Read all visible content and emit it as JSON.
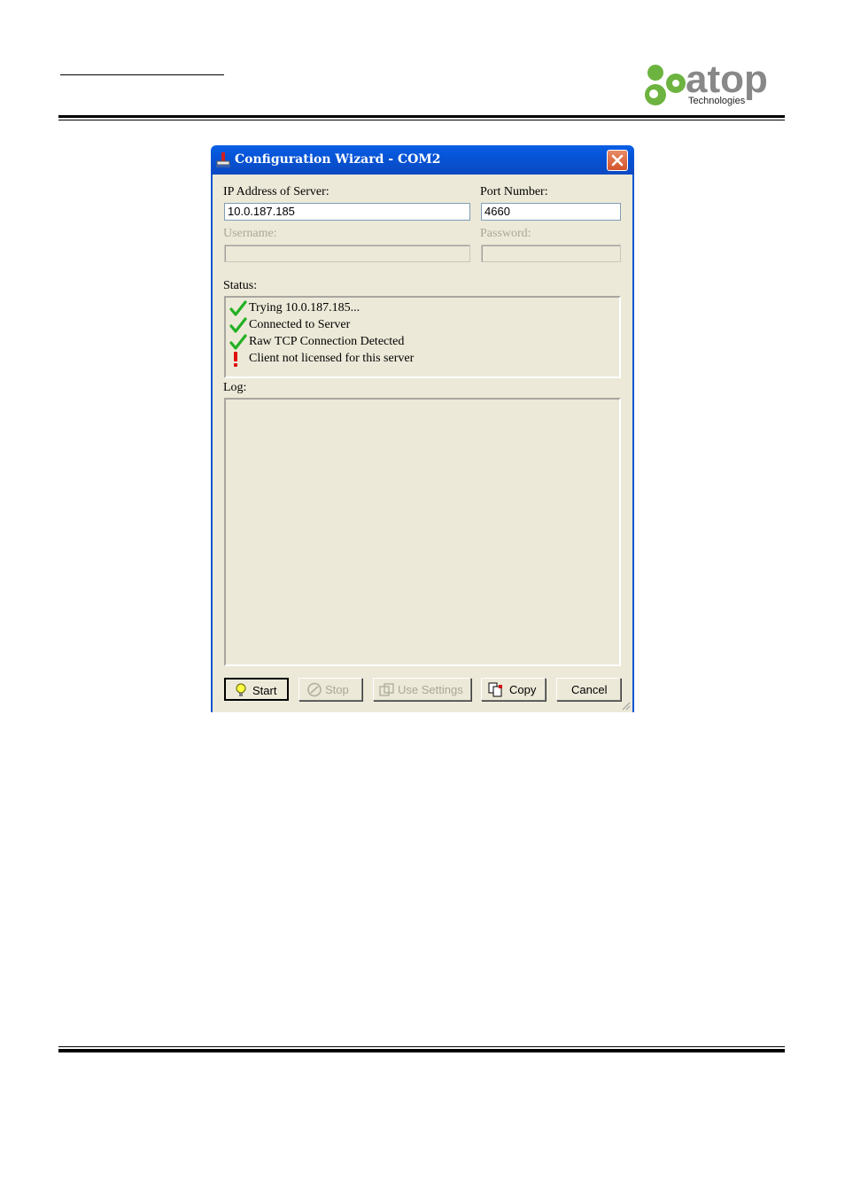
{
  "logo": {
    "wordmark": "atop",
    "tagline": "Technologies",
    "brand_colors": {
      "green": "#6cb33f",
      "grey": "#888888"
    }
  },
  "window": {
    "title": "Configuration Wizard - COM2",
    "close_icon": "close-x-icon",
    "fields": {
      "ip_label": "IP Address of Server:",
      "ip_value": "10.0.187.185",
      "port_label": "Port Number:",
      "port_value": "4660",
      "username_label": "Username:",
      "username_value": "",
      "password_label": "Password:",
      "password_value": ""
    },
    "status": {
      "label": "Status:",
      "items": [
        {
          "icon": "green-check-icon",
          "text": "Trying 10.0.187.185..."
        },
        {
          "icon": "green-check-icon",
          "text": "Connected to Server"
        },
        {
          "icon": "green-check-icon",
          "text": "Raw TCP Connection Detected"
        },
        {
          "icon": "red-exclamation-icon",
          "text": "Client not licensed for this server"
        }
      ]
    },
    "log": {
      "label": "Log:"
    },
    "buttons": {
      "start": "Start",
      "stop": "Stop",
      "use_settings": "Use Settings",
      "copy": "Copy",
      "cancel": "Cancel"
    }
  }
}
